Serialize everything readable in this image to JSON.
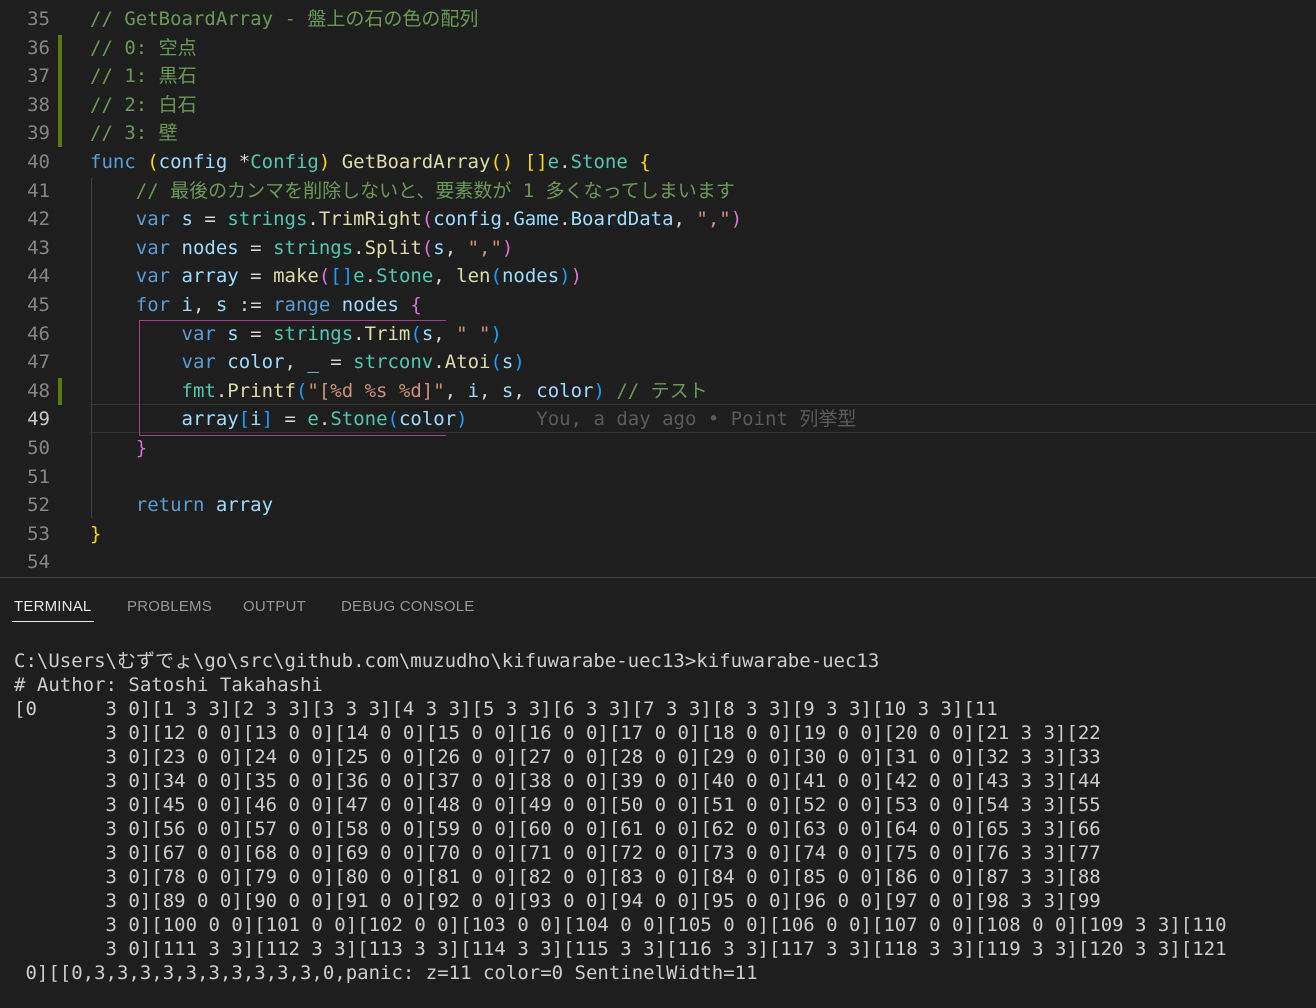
{
  "editor": {
    "active_line": 49,
    "lines": [
      {
        "n": 35,
        "tokens": [
          {
            "t": "// GetBoardArray - 盤上の石の色の配列",
            "c": "cm"
          }
        ]
      },
      {
        "n": 36,
        "tokens": [
          {
            "t": "// 0: 空点",
            "c": "cm"
          }
        ]
      },
      {
        "n": 37,
        "tokens": [
          {
            "t": "// 1: 黒石",
            "c": "cm"
          }
        ]
      },
      {
        "n": 38,
        "tokens": [
          {
            "t": "// 2: 白石",
            "c": "cm"
          }
        ]
      },
      {
        "n": 39,
        "tokens": [
          {
            "t": "// 3: 壁",
            "c": "cm"
          }
        ]
      },
      {
        "n": 40,
        "tokens": [
          {
            "t": "func ",
            "c": "kw"
          },
          {
            "t": "(",
            "c": "b1"
          },
          {
            "t": "config ",
            "c": "vr"
          },
          {
            "t": "*",
            "c": "pl"
          },
          {
            "t": "Config",
            "c": "ty"
          },
          {
            "t": ") ",
            "c": "b1"
          },
          {
            "t": "GetBoardArray",
            "c": "fn"
          },
          {
            "t": "() ",
            "c": "b1"
          },
          {
            "t": "[]",
            "c": "b1"
          },
          {
            "t": "e",
            "c": "ty"
          },
          {
            "t": ".",
            "c": "pl"
          },
          {
            "t": "Stone ",
            "c": "ty"
          },
          {
            "t": "{",
            "c": "b1"
          }
        ]
      },
      {
        "n": 41,
        "tokens": [
          {
            "t": "    ",
            "c": "pl"
          },
          {
            "t": "// 最後のカンマを削除しないと、要素数が 1 多くなってしまいます",
            "c": "cm"
          }
        ]
      },
      {
        "n": 42,
        "tokens": [
          {
            "t": "    ",
            "c": "pl"
          },
          {
            "t": "var ",
            "c": "kw"
          },
          {
            "t": "s ",
            "c": "vr"
          },
          {
            "t": "= ",
            "c": "pl"
          },
          {
            "t": "strings",
            "c": "ty"
          },
          {
            "t": ".",
            "c": "pl"
          },
          {
            "t": "TrimRight",
            "c": "fn"
          },
          {
            "t": "(",
            "c": "b2"
          },
          {
            "t": "config",
            "c": "vr"
          },
          {
            "t": ".",
            "c": "pl"
          },
          {
            "t": "Game",
            "c": "vr"
          },
          {
            "t": ".",
            "c": "pl"
          },
          {
            "t": "BoardData",
            "c": "vr"
          },
          {
            "t": ", ",
            "c": "pl"
          },
          {
            "t": "\",\"",
            "c": "st"
          },
          {
            "t": ")",
            "c": "b2"
          }
        ]
      },
      {
        "n": 43,
        "tokens": [
          {
            "t": "    ",
            "c": "pl"
          },
          {
            "t": "var ",
            "c": "kw"
          },
          {
            "t": "nodes ",
            "c": "vr"
          },
          {
            "t": "= ",
            "c": "pl"
          },
          {
            "t": "strings",
            "c": "ty"
          },
          {
            "t": ".",
            "c": "pl"
          },
          {
            "t": "Split",
            "c": "fn"
          },
          {
            "t": "(",
            "c": "b2"
          },
          {
            "t": "s",
            "c": "vr"
          },
          {
            "t": ", ",
            "c": "pl"
          },
          {
            "t": "\",\"",
            "c": "st"
          },
          {
            "t": ")",
            "c": "b2"
          }
        ]
      },
      {
        "n": 44,
        "tokens": [
          {
            "t": "    ",
            "c": "pl"
          },
          {
            "t": "var ",
            "c": "kw"
          },
          {
            "t": "array ",
            "c": "vr"
          },
          {
            "t": "= ",
            "c": "pl"
          },
          {
            "t": "make",
            "c": "fn"
          },
          {
            "t": "(",
            "c": "b2"
          },
          {
            "t": "[]",
            "c": "b3"
          },
          {
            "t": "e",
            "c": "ty"
          },
          {
            "t": ".",
            "c": "pl"
          },
          {
            "t": "Stone",
            "c": "ty"
          },
          {
            "t": ", ",
            "c": "pl"
          },
          {
            "t": "len",
            "c": "fn"
          },
          {
            "t": "(",
            "c": "b3"
          },
          {
            "t": "nodes",
            "c": "vr"
          },
          {
            "t": ")",
            "c": "b3"
          },
          {
            "t": ")",
            "c": "b2"
          }
        ]
      },
      {
        "n": 45,
        "tokens": [
          {
            "t": "    ",
            "c": "pl"
          },
          {
            "t": "for ",
            "c": "kw"
          },
          {
            "t": "i",
            "c": "vr"
          },
          {
            "t": ", ",
            "c": "pl"
          },
          {
            "t": "s ",
            "c": "vr"
          },
          {
            "t": ":= ",
            "c": "pl"
          },
          {
            "t": "range ",
            "c": "kw"
          },
          {
            "t": "nodes ",
            "c": "vr"
          },
          {
            "t": "{",
            "c": "b2"
          }
        ]
      },
      {
        "n": 46,
        "tokens": [
          {
            "t": "        ",
            "c": "pl"
          },
          {
            "t": "var ",
            "c": "kw"
          },
          {
            "t": "s ",
            "c": "vr"
          },
          {
            "t": "= ",
            "c": "pl"
          },
          {
            "t": "strings",
            "c": "ty"
          },
          {
            "t": ".",
            "c": "pl"
          },
          {
            "t": "Trim",
            "c": "fn"
          },
          {
            "t": "(",
            "c": "b3"
          },
          {
            "t": "s",
            "c": "vr"
          },
          {
            "t": ", ",
            "c": "pl"
          },
          {
            "t": "\" \"",
            "c": "st"
          },
          {
            "t": ")",
            "c": "b3"
          }
        ]
      },
      {
        "n": 47,
        "tokens": [
          {
            "t": "        ",
            "c": "pl"
          },
          {
            "t": "var ",
            "c": "kw"
          },
          {
            "t": "color",
            "c": "vr"
          },
          {
            "t": ", ",
            "c": "pl"
          },
          {
            "t": "_ ",
            "c": "vr"
          },
          {
            "t": "= ",
            "c": "pl"
          },
          {
            "t": "strconv",
            "c": "ty"
          },
          {
            "t": ".",
            "c": "pl"
          },
          {
            "t": "Atoi",
            "c": "fn"
          },
          {
            "t": "(",
            "c": "b3"
          },
          {
            "t": "s",
            "c": "vr"
          },
          {
            "t": ")",
            "c": "b3"
          }
        ]
      },
      {
        "n": 48,
        "tokens": [
          {
            "t": "        ",
            "c": "pl"
          },
          {
            "t": "fmt",
            "c": "ty"
          },
          {
            "t": ".",
            "c": "pl"
          },
          {
            "t": "Printf",
            "c": "fn"
          },
          {
            "t": "(",
            "c": "b3"
          },
          {
            "t": "\"[%d %s %d]\"",
            "c": "st"
          },
          {
            "t": ", ",
            "c": "pl"
          },
          {
            "t": "i",
            "c": "vr"
          },
          {
            "t": ", ",
            "c": "pl"
          },
          {
            "t": "s",
            "c": "vr"
          },
          {
            "t": ", ",
            "c": "pl"
          },
          {
            "t": "color",
            "c": "vr"
          },
          {
            "t": ") ",
            "c": "b3"
          },
          {
            "t": "// テスト",
            "c": "cm"
          }
        ]
      },
      {
        "n": 49,
        "tokens": [
          {
            "t": "        ",
            "c": "pl"
          },
          {
            "t": "array",
            "c": "vr"
          },
          {
            "t": "[",
            "c": "b3"
          },
          {
            "t": "i",
            "c": "vr"
          },
          {
            "t": "] ",
            "c": "b3"
          },
          {
            "t": "= ",
            "c": "pl"
          },
          {
            "t": "e",
            "c": "ty"
          },
          {
            "t": ".",
            "c": "pl"
          },
          {
            "t": "Stone",
            "c": "ty"
          },
          {
            "t": "(",
            "c": "b3"
          },
          {
            "t": "color",
            "c": "vr"
          },
          {
            "t": ")",
            "c": "b3"
          },
          {
            "t": "      You, a day ago • Point 列挙型",
            "c": "blame"
          }
        ]
      },
      {
        "n": 50,
        "tokens": [
          {
            "t": "    ",
            "c": "pl"
          },
          {
            "t": "}",
            "c": "b2"
          }
        ]
      },
      {
        "n": 51,
        "tokens": []
      },
      {
        "n": 52,
        "tokens": [
          {
            "t": "    ",
            "c": "pl"
          },
          {
            "t": "return ",
            "c": "kw"
          },
          {
            "t": "array",
            "c": "vr"
          }
        ]
      },
      {
        "n": 53,
        "tokens": [
          {
            "t": "}",
            "c": "b1"
          }
        ]
      },
      {
        "n": 54,
        "tokens": []
      }
    ]
  },
  "panel": {
    "tabs": [
      {
        "label": "TERMINAL",
        "active": true
      },
      {
        "label": "PROBLEMS",
        "active": false
      },
      {
        "label": "OUTPUT",
        "active": false
      },
      {
        "label": "DEBUG CONSOLE",
        "active": false
      }
    ],
    "terminal_lines": [
      "C:\\Users\\むずでょ\\go\\src\\github.com\\muzudho\\kifuwarabe-uec13>kifuwarabe-uec13",
      "# Author: Satoshi Takahashi",
      "[0      3 0][1 3 3][2 3 3][3 3 3][4 3 3][5 3 3][6 3 3][7 3 3][8 3 3][9 3 3][10 3 3][11",
      "        3 0][12 0 0][13 0 0][14 0 0][15 0 0][16 0 0][17 0 0][18 0 0][19 0 0][20 0 0][21 3 3][22",
      "        3 0][23 0 0][24 0 0][25 0 0][26 0 0][27 0 0][28 0 0][29 0 0][30 0 0][31 0 0][32 3 3][33",
      "        3 0][34 0 0][35 0 0][36 0 0][37 0 0][38 0 0][39 0 0][40 0 0][41 0 0][42 0 0][43 3 3][44",
      "        3 0][45 0 0][46 0 0][47 0 0][48 0 0][49 0 0][50 0 0][51 0 0][52 0 0][53 0 0][54 3 3][55",
      "        3 0][56 0 0][57 0 0][58 0 0][59 0 0][60 0 0][61 0 0][62 0 0][63 0 0][64 0 0][65 3 3][66",
      "        3 0][67 0 0][68 0 0][69 0 0][70 0 0][71 0 0][72 0 0][73 0 0][74 0 0][75 0 0][76 3 3][77",
      "        3 0][78 0 0][79 0 0][80 0 0][81 0 0][82 0 0][83 0 0][84 0 0][85 0 0][86 0 0][87 3 3][88",
      "        3 0][89 0 0][90 0 0][91 0 0][92 0 0][93 0 0][94 0 0][95 0 0][96 0 0][97 0 0][98 3 3][99",
      "        3 0][100 0 0][101 0 0][102 0 0][103 0 0][104 0 0][105 0 0][106 0 0][107 0 0][108 0 0][109 3 3][110",
      "        3 0][111 3 3][112 3 3][113 3 3][114 3 3][115 3 3][116 3 3][117 3 3][118 3 3][119 3 3][120 3 3][121",
      " 0][[0,3,3,3,3,3,3,3,3,3,3,0,panic: z=11 color=0 SentinelWidth=11"
    ]
  }
}
